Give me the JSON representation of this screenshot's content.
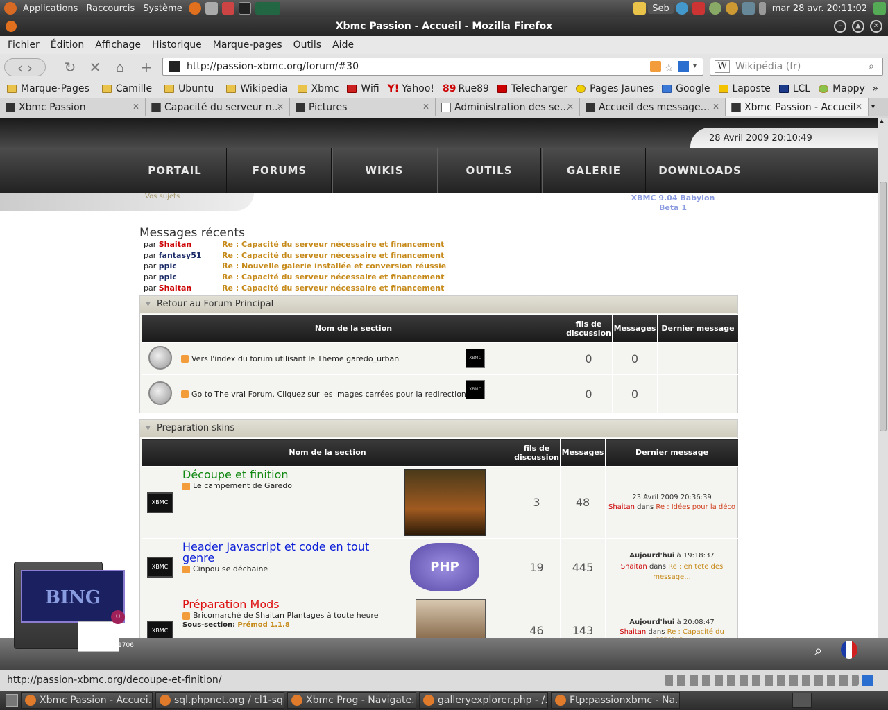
{
  "panel": {
    "menus": [
      "Applications",
      "Raccourcis",
      "Système"
    ],
    "user": "Seb",
    "clock": "mar 28 avr. 20:11:02"
  },
  "window": {
    "title": "Xbmc Passion - Accueil - Mozilla Firefox"
  },
  "menubar": [
    "Fichier",
    "Édition",
    "Affichage",
    "Historique",
    "Marque-pages",
    "Outils",
    "Aide"
  ],
  "navbar": {
    "url": "http://passion-xbmc.org/forum/#30",
    "search_placeholder": "Wikipédia (fr)"
  },
  "bookmarks": [
    "Marque-Pages",
    "Camille",
    "Ubuntu",
    "Wikipedia",
    "Xbmc",
    "Wifi",
    "Yahoo!",
    "Rue89",
    "Telecharger",
    "Pages Jaunes",
    "Google",
    "Laposte",
    "LCL",
    "Mappy"
  ],
  "tabs": [
    {
      "label": "Xbmc Passion"
    },
    {
      "label": "Capacité du serveur n..."
    },
    {
      "label": "Pictures"
    },
    {
      "label": "Administration des se..."
    },
    {
      "label": "Accueil des message..."
    },
    {
      "label": "Xbmc Passion - Accueil"
    }
  ],
  "page": {
    "date": "28 Avril 2009 20:10:49",
    "nav": [
      "PORTAIL",
      "FORUMS",
      "WIKIS",
      "OUTILS",
      "GALERIE",
      "DOWNLOADS"
    ],
    "vos_sujets": "Vos sujets",
    "xbmc_version": "XBMC 9.04 Babylon",
    "xbmc_version_2": "Beta 1",
    "recent_title": "Messages récents",
    "par": "par",
    "recent": [
      {
        "user": "Shaitan",
        "user_color": "#cc0000",
        "topic": "Re : Capacité du serveur nécessaire et financement"
      },
      {
        "user": "fantasy51",
        "user_color": "#1a2a66",
        "topic": "Re : Capacité du serveur nécessaire et financement"
      },
      {
        "user": "ppic",
        "user_color": "#1a2a66",
        "topic": "Re : Nouvelle galerie installée et conversion réussie"
      },
      {
        "user": "ppic",
        "user_color": "#1a2a66",
        "topic": "Re : Capacité du serveur nécessaire et financement"
      },
      {
        "user": "Shaitan",
        "user_color": "#cc0000",
        "topic": "Re : Capacité du serveur nécessaire et financement"
      }
    ],
    "table_headers": {
      "name": "Nom de la section",
      "threads": "fils de discussion",
      "messages": "Messages",
      "last": "Dernier message"
    },
    "section1": {
      "title": "Retour au Forum Principal",
      "rows": [
        {
          "text": "Vers l'index du forum utilisant le Theme garedo_urban",
          "threads": "0",
          "messages": "0"
        },
        {
          "text": "Go to The vrai Forum. Cliquez sur les images carrées pour la redirection",
          "threads": "0",
          "messages": "0"
        }
      ]
    },
    "section2": {
      "title": "Preparation skins",
      "rows": [
        {
          "title": "Découpe et finition",
          "title_color": "#118811",
          "desc": "Le campement de Garedo",
          "threads": "3",
          "messages": "48",
          "last_date": "23 Avril 2009 20:36:39",
          "last_user": "Shaitan",
          "dans": "dans",
          "last_msg": "Re : Idées pour la déco"
        },
        {
          "title": "Header Javascript et code en tout genre",
          "title_color": "#0b1ed8",
          "desc": "Cinpou se déchaine",
          "threads": "19",
          "messages": "445",
          "last_date_bold": "Aujourd'hui",
          "last_date": "à 19:18:37",
          "last_user": "Shaitan",
          "dans": "dans",
          "last_msg": "Re : en tete des message..."
        },
        {
          "title": "Préparation Mods",
          "title_color": "#dd1111",
          "desc": "Bricomarché de Shaitan Plantages à toute heure",
          "sub_label": "Sous-section:",
          "sub_value": "Prémod 1.1.8",
          "threads": "46",
          "messages": "143",
          "last_date_bold": "Aujourd'hui",
          "last_date": "à 20:08:47",
          "last_user": "Shaitan",
          "dans": "dans",
          "last_msg": "Re : Capacité du serveur..."
        }
      ]
    }
  },
  "widget": {
    "badge": "0",
    "count": "1706"
  },
  "statusbar": {
    "text": "http://passion-xbmc.org/decoupe-et-finition/"
  },
  "taskbar": [
    "Xbmc Passion - Accuei...",
    "sql.phpnet.org / cl1-sq...",
    "Xbmc Prog - Navigate...",
    "galleryexplorer.php - /...",
    "Ftp:passionxbmc - Na..."
  ]
}
